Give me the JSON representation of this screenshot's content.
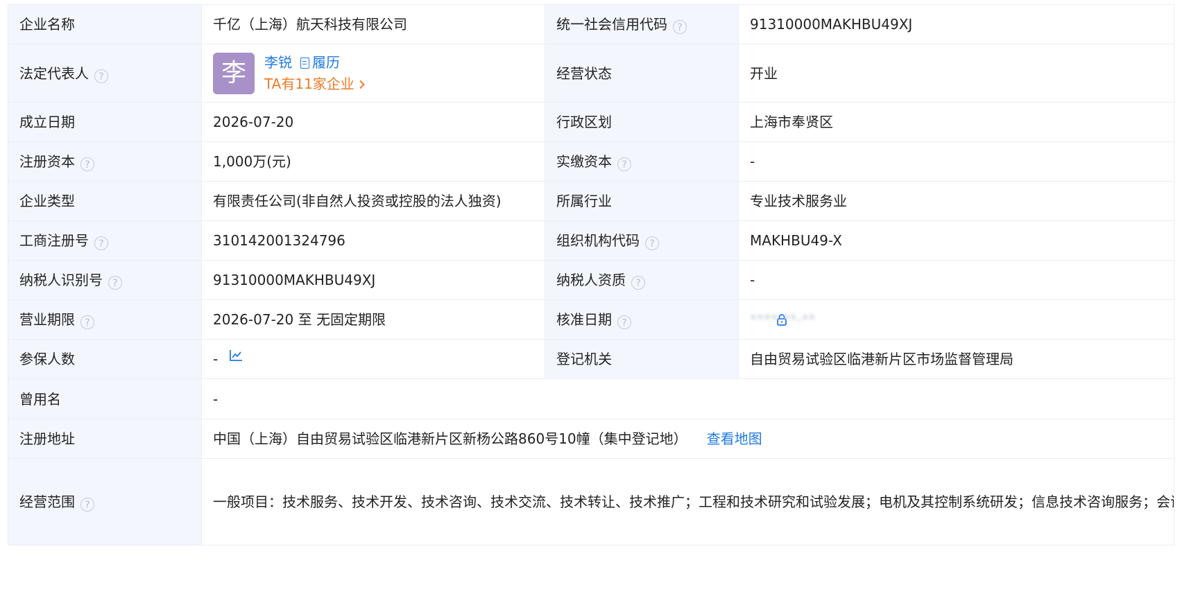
{
  "rows": [
    {
      "l1": "企业名称",
      "v1": "千亿（上海）航天科技有限公司",
      "l2": "统一社会信用代码",
      "v2": "91310000MAKHBU49XJ"
    },
    {
      "l1": "法定代表人",
      "l2": "经营状态",
      "v2": "开业"
    },
    {
      "l1": "成立日期",
      "v1": "2026-07-20",
      "l2": "行政区划",
      "v2": "上海市奉贤区"
    },
    {
      "l1": "注册资本",
      "v1": "1,000万(元)",
      "l2": "实缴资本",
      "v2": "-"
    },
    {
      "l1": "企业类型",
      "v1": "有限责任公司(非自然人投资或控股的法人独资)",
      "l2": "所属行业",
      "v2": "专业技术服务业"
    },
    {
      "l1": "工商注册号",
      "v1": "310142001324796",
      "l2": "组织机构代码",
      "v2": "MAKHBU49-X"
    },
    {
      "l1": "纳税人识别号",
      "v1": "91310000MAKHBU49XJ",
      "l2": "纳税人资质",
      "v2": "-"
    },
    {
      "l1": "营业期限",
      "v1": "2026-07-20 至 无固定期限",
      "l2": "核准日期",
      "v2": "****-**-**"
    },
    {
      "l1": "参保人数",
      "v1": "-",
      "l2": "登记机关",
      "v2": "自由贸易试验区临港新片区市场监督管理局"
    },
    {
      "l1": "曾用名",
      "v1": "-"
    },
    {
      "l1": "注册地址",
      "v1": "中国（上海）自由贸易试验区临港新片区新杨公路860号10幢（集中登记地）"
    },
    {
      "l1": "经营范围",
      "v1": "一般项目：技术服务、技术开发、技术咨询、技术交流、技术转让、技术推广；工程和技术研究和试验发展；电机及其控制系统研发；信息技术咨询服务；会议及展览服务（出国办展须经相关部门审批）；货物进出口；技术进出口；进出口代理。（除依法须经批准的项目外，凭营业执照依法自主开展经营活动）"
    }
  ],
  "legal_rep": {
    "avatar_char": "李",
    "name": "李锐",
    "resume_label": "履历",
    "companies_label": "TA有11家企业"
  },
  "help_mark": "?",
  "address_map_link": "查看地图",
  "colors": {
    "label_bg": "#f3f7fd",
    "link": "#1f7ae0",
    "orange": "#f07a25",
    "avatar_bg": "#a890c8",
    "border": "#e9edf3"
  },
  "icons": [
    "question-circle-icon",
    "resume-icon",
    "chevron-right-icon",
    "lock-icon",
    "line-chart-icon"
  ]
}
